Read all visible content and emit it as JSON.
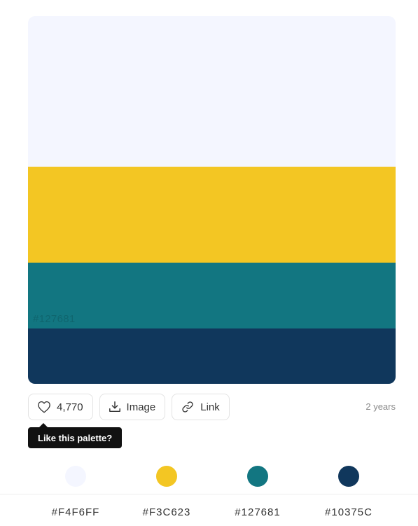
{
  "palette": {
    "colors": [
      "#F4F6FF",
      "#F3C623",
      "#127681",
      "#10375C"
    ],
    "hover_label": "#127681"
  },
  "actions": {
    "like_count": "4,770",
    "image_label": "Image",
    "link_label": "Link",
    "date": "2 years"
  },
  "tooltip": {
    "text": "Like this palette?"
  },
  "icons": {
    "like": "heart-icon",
    "image": "download-icon",
    "link": "link-icon"
  }
}
